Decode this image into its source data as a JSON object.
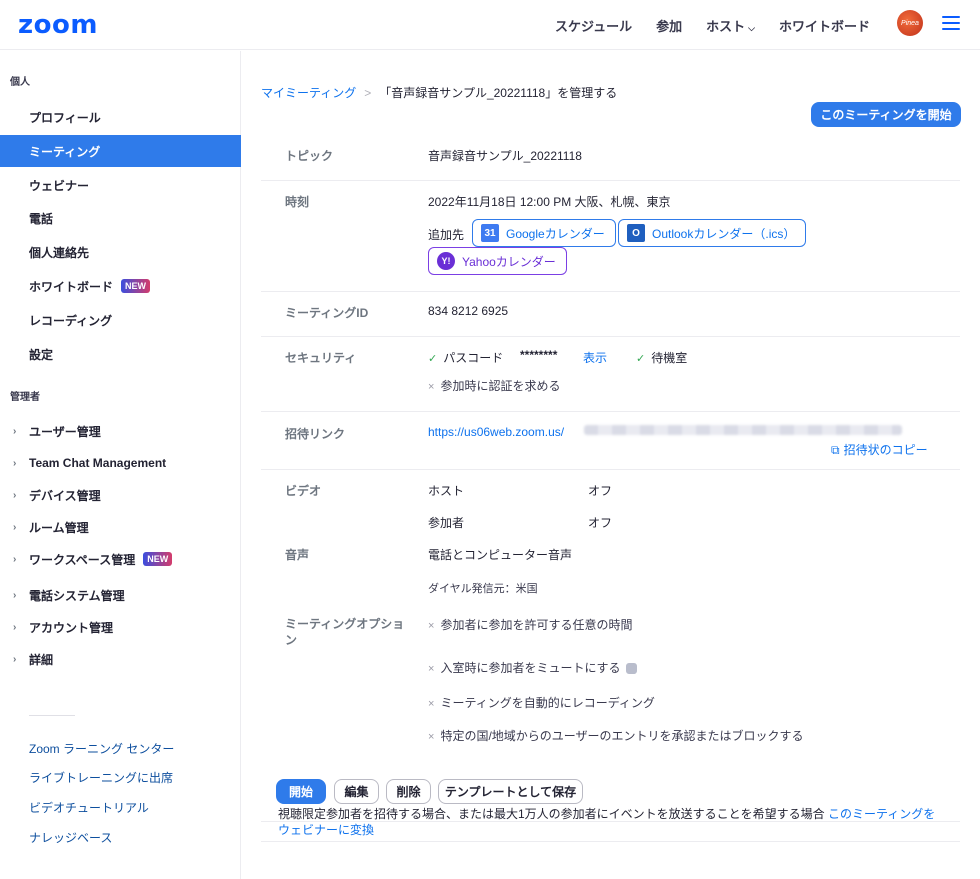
{
  "header": {
    "logo": "zoom",
    "nav": [
      "スケジュール",
      "参加",
      "ホスト",
      "ホワイトボード"
    ],
    "avatar_text": "Pinea"
  },
  "sidebar": {
    "personal_title": "個人",
    "personal_items": [
      "プロフィール",
      "ミーティング",
      "ウェビナー",
      "電話",
      "個人連絡先",
      "ホワイトボード",
      "レコーディング",
      "設定"
    ],
    "new_badge": "NEW",
    "admin_title": "管理者",
    "admin_items": [
      "ユーザー管理",
      "Team Chat Management",
      "デバイス管理",
      "ルーム管理",
      "ワークスペース管理",
      "電話システム管理",
      "アカウント管理",
      "詳細"
    ],
    "links": [
      "Zoom ラーニング センター",
      "ライブトレーニングに出席",
      "ビデオチュートリアル",
      "ナレッジベース"
    ]
  },
  "breadcrumb": {
    "parent": "マイミーティング",
    "sep": ">",
    "current": "「音声録音サンプル_20221118」を管理する"
  },
  "start_top_label": "このミーティングを開始",
  "topic": {
    "label": "トピック",
    "value": "音声録音サンプル_20221118"
  },
  "time": {
    "label": "時刻",
    "value": "2022年11月18日 12:00 PM 大阪、札幌、東京",
    "add_to": "追加先",
    "google": "Googleカレンダー",
    "google_icon_text": "31",
    "outlook": "Outlookカレンダー（.ics）",
    "outlook_icon_text": "O",
    "yahoo": "Yahooカレンダー",
    "yahoo_icon_text": "Y!"
  },
  "meeting_id": {
    "label": "ミーティングID",
    "value": "834 8212 6925"
  },
  "security": {
    "label": "セキュリティ",
    "passcode_label": "パスコード",
    "passcode_value": "********",
    "show": "表示",
    "waiting_room": "待機室",
    "auth": "参加時に認証を求める"
  },
  "invite": {
    "label": "招待リンク",
    "url": "https://us06web.zoom.us/",
    "copy": "招待状のコピー"
  },
  "video": {
    "label": "ビデオ",
    "host_label": "ホスト",
    "host_value": "オフ",
    "participant_label": "参加者",
    "participant_value": "オフ"
  },
  "audio": {
    "label": "音声",
    "value": "電話とコンピューター音声",
    "dial": "ダイヤル発信元：米国"
  },
  "options": {
    "label": "ミーティングオプション",
    "items": [
      "参加者に参加を許可する任意の時間",
      "入室時に参加者をミュートにする",
      "ミーティングを自動的にレコーディング",
      "特定の国/地域からのユーザーのエントリを承認またはブロックする"
    ]
  },
  "actions": [
    "開始",
    "編集",
    "削除",
    "テンプレートとして保存"
  ],
  "footnote": {
    "text": "視聴限定参加者を招待する場合、または最大1万人の参加者にイベントを放送することを希望する場合 ",
    "link": "このミーティングをウェビナーに変換"
  },
  "colors": {
    "accent": "#2f7bea",
    "logo": "#0b5cff"
  }
}
